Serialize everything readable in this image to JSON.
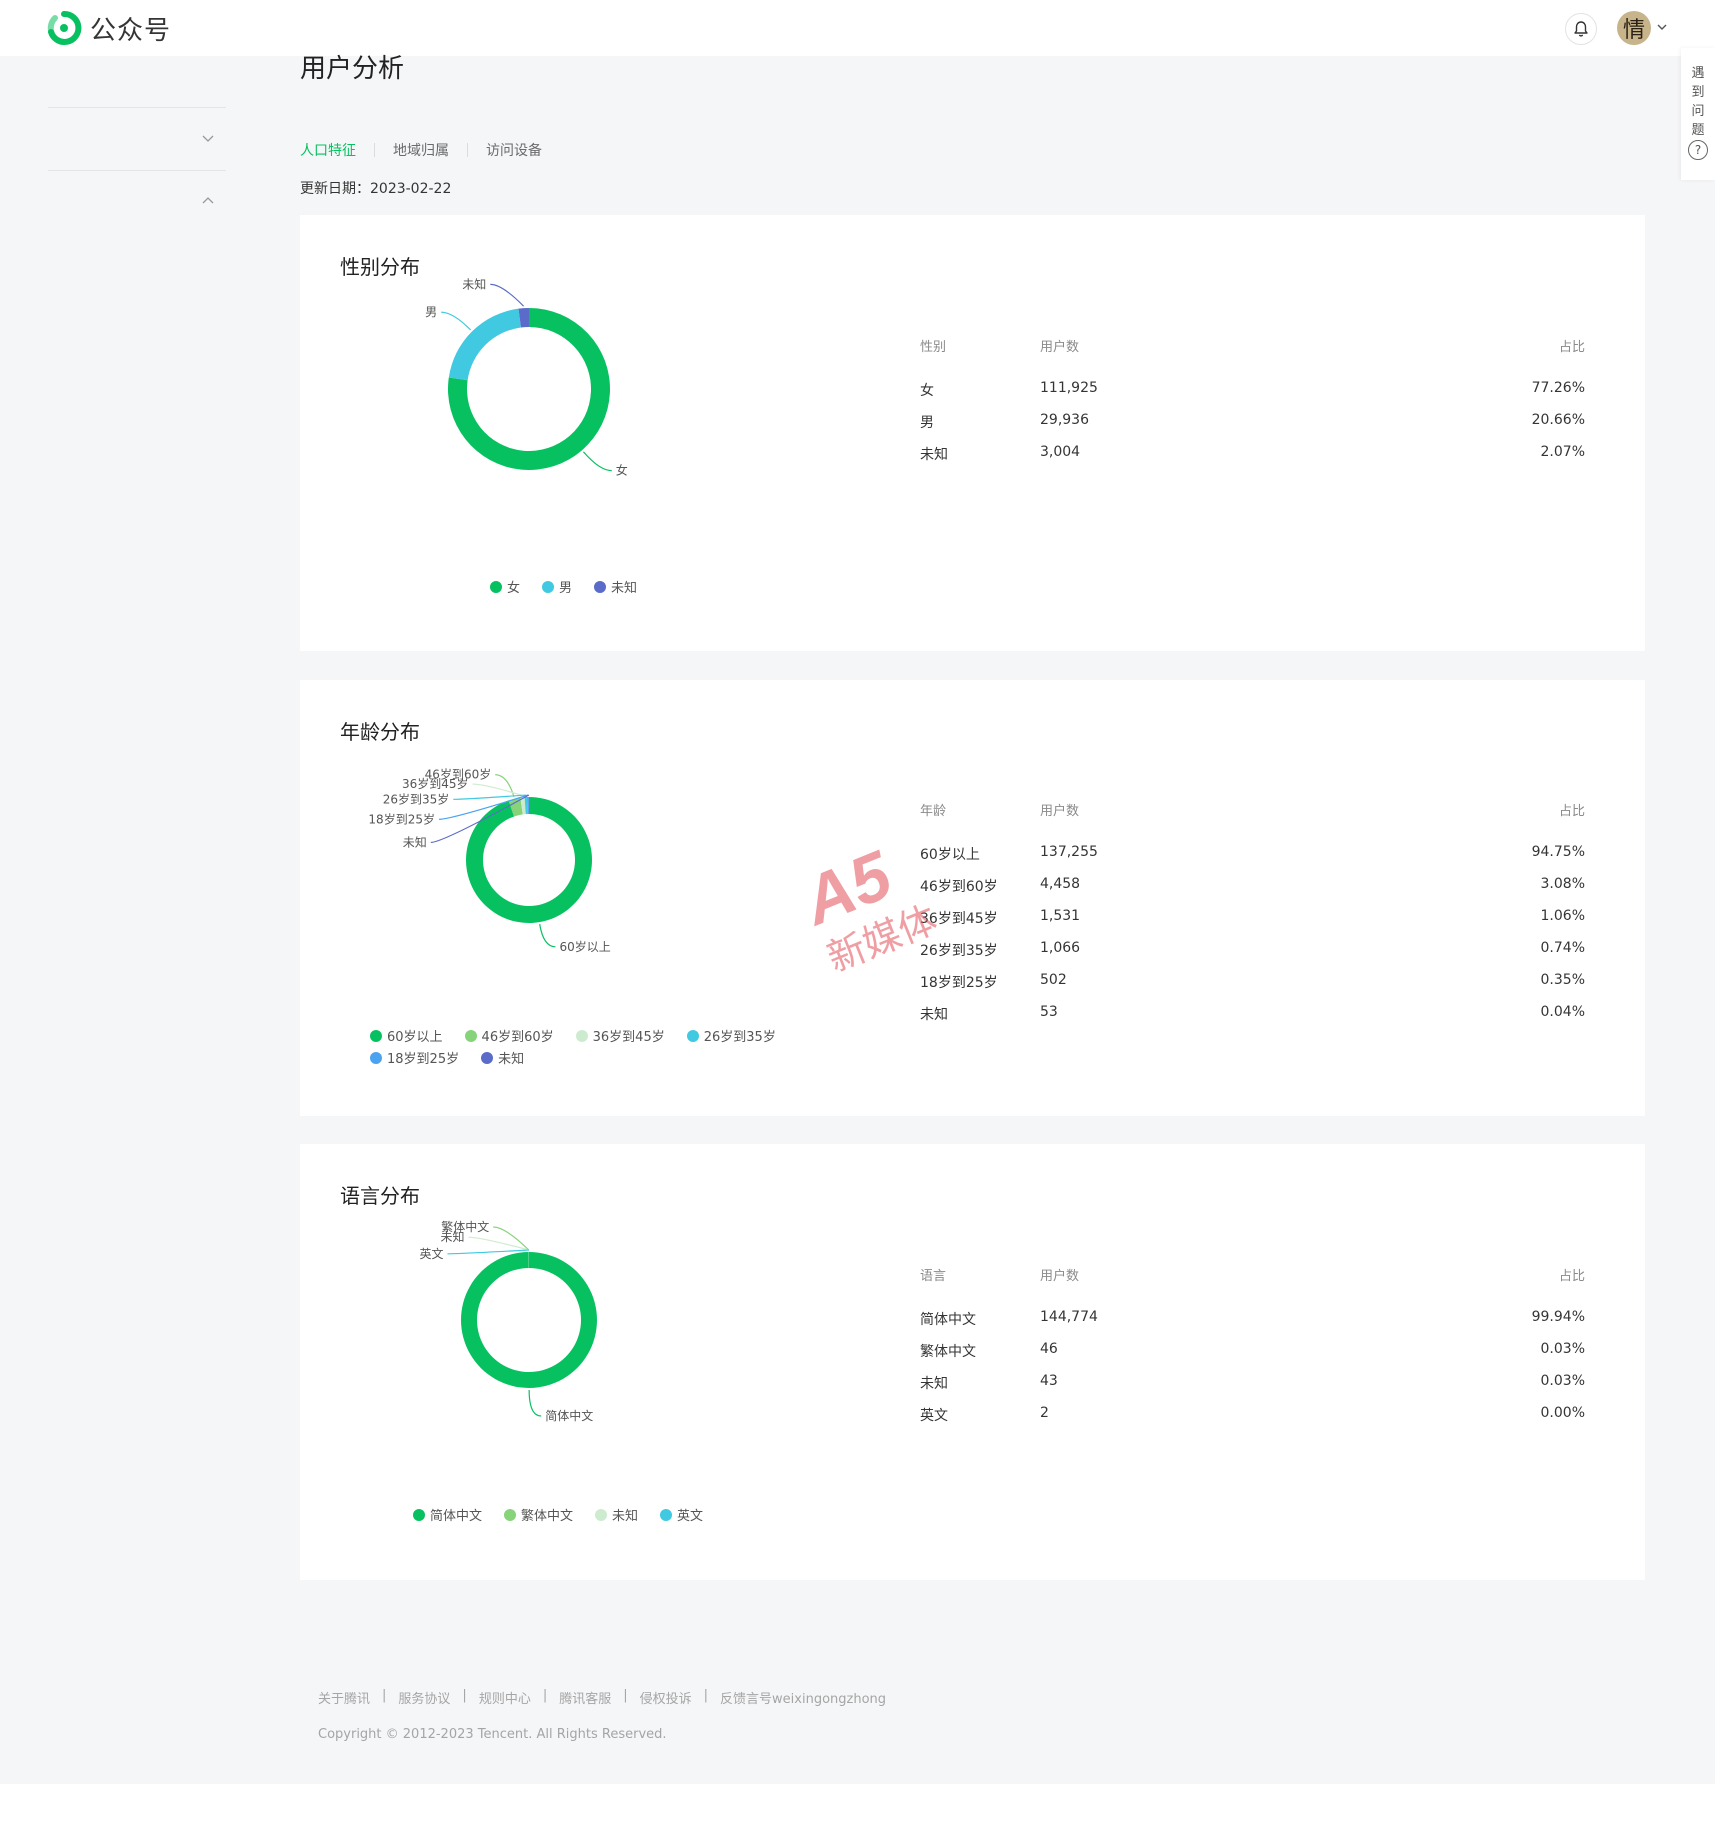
{
  "app": {
    "name": "公众号",
    "avatar_char": "情",
    "help_tab": "遇到问题",
    "help_icon": "?"
  },
  "page": {
    "title": "用户分析",
    "tabs": [
      {
        "label": "人口特征",
        "active": true
      },
      {
        "label": "地域归属",
        "active": false
      },
      {
        "label": "访问设备",
        "active": false
      }
    ],
    "update_label": "更新日期：",
    "update_date": "2023-02-22"
  },
  "colors": {
    "brand_green": "#07c160",
    "cyan": "#40c9e0",
    "indigo": "#5b6bc9",
    "light_green": "#86d37a",
    "pale_green": "#cdeccf",
    "blue": "#4aa3ef"
  },
  "icons": {
    "logo": "wechat-official-account-logo",
    "bell": "bell-icon",
    "dropdown": "chevron-down-icon",
    "collapse": "chevron-up-icon",
    "help": "question-circle-icon"
  },
  "gender": {
    "title": "性别分布",
    "columns": [
      "性别",
      "用户数",
      "占比"
    ],
    "rows": [
      {
        "label": "女",
        "count": "111,925",
        "pct": "77.26%"
      },
      {
        "label": "男",
        "count": "29,936",
        "pct": "20.66%"
      },
      {
        "label": "未知",
        "count": "3,004",
        "pct": "2.07%"
      }
    ]
  },
  "age": {
    "title": "年龄分布",
    "columns": [
      "年龄",
      "用户数",
      "占比"
    ],
    "rows": [
      {
        "label": "60岁以上",
        "count": "137,255",
        "pct": "94.75%"
      },
      {
        "label": "46岁到60岁",
        "count": "4,458",
        "pct": "3.08%"
      },
      {
        "label": "36岁到45岁",
        "count": "1,531",
        "pct": "1.06%"
      },
      {
        "label": "26岁到35岁",
        "count": "1,066",
        "pct": "0.74%"
      },
      {
        "label": "18岁到25岁",
        "count": "502",
        "pct": "0.35%"
      },
      {
        "label": "未知",
        "count": "53",
        "pct": "0.04%"
      }
    ]
  },
  "language": {
    "title": "语言分布",
    "columns": [
      "语言",
      "用户数",
      "占比"
    ],
    "rows": [
      {
        "label": "简体中文",
        "count": "144,774",
        "pct": "99.94%"
      },
      {
        "label": "繁体中文",
        "count": "46",
        "pct": "0.03%"
      },
      {
        "label": "未知",
        "count": "43",
        "pct": "0.03%"
      },
      {
        "label": "英文",
        "count": "2",
        "pct": "0.00%"
      }
    ]
  },
  "chart_data": [
    {
      "type": "pie",
      "title": "性别分布",
      "categories": [
        "女",
        "男",
        "未知"
      ],
      "values": [
        111925,
        29936,
        3004
      ],
      "colors": [
        "#07c160",
        "#40c9e0",
        "#5b6bc9"
      ],
      "legend": "bottom"
    },
    {
      "type": "pie",
      "title": "年龄分布",
      "categories": [
        "60岁以上",
        "46岁到60岁",
        "36岁到45岁",
        "26岁到35岁",
        "18岁到25岁",
        "未知"
      ],
      "values": [
        137255,
        4458,
        1531,
        1066,
        502,
        53
      ],
      "colors": [
        "#07c160",
        "#86d37a",
        "#cdeccf",
        "#40c9e0",
        "#4aa3ef",
        "#5b6bc9"
      ],
      "legend": "bottom"
    },
    {
      "type": "pie",
      "title": "语言分布",
      "categories": [
        "简体中文",
        "繁体中文",
        "未知",
        "英文"
      ],
      "values": [
        144774,
        46,
        43,
        2
      ],
      "colors": [
        "#07c160",
        "#86d37a",
        "#cdeccf",
        "#40c9e0"
      ],
      "legend": "bottom"
    }
  ],
  "watermark": {
    "brand": "A5",
    "text": "新媒体"
  },
  "footer": {
    "links": [
      "关于腾讯",
      "服务协议",
      "规则中心",
      "腾讯客服",
      "侵权投诉",
      "反馈言号weixingongzhong"
    ],
    "separator": "|",
    "copyright": "Copyright © 2012-2023 Tencent. All Rights Reserved."
  }
}
